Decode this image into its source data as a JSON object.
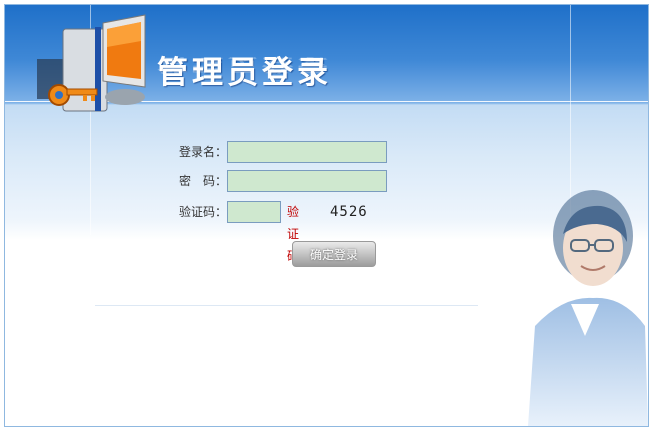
{
  "header": {
    "title": "管理员登录",
    "logo_icon": "key-computer-icon"
  },
  "form": {
    "username": {
      "label": "登录名：",
      "value": ""
    },
    "password": {
      "label": "密　码：",
      "value": ""
    },
    "captcha": {
      "label": "验证码：",
      "value": "",
      "link_label": "验证码",
      "code": "4526"
    },
    "submit_label": "确定登录"
  },
  "colors": {
    "header_blue": "#1f70c9",
    "input_bg": "#cfe8cf",
    "captcha_red": "#c00000"
  }
}
